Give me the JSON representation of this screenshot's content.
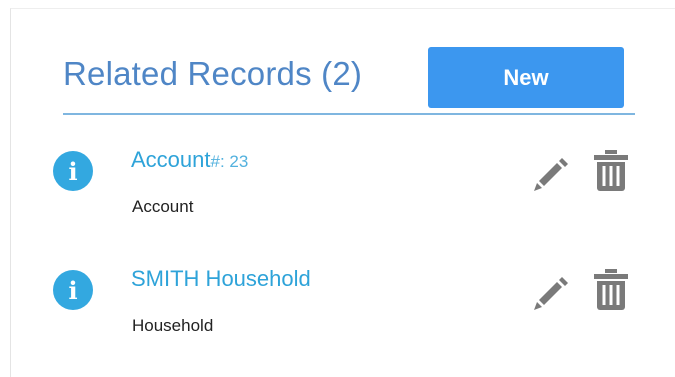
{
  "header": {
    "title": "Related Records (2)",
    "new_label": "New"
  },
  "records": [
    {
      "name": "Account",
      "number": "#: 23",
      "type": "Account",
      "icon": "info-icon"
    },
    {
      "name": "SMITH Household",
      "number": "",
      "type": "Household",
      "icon": "info-icon"
    }
  ],
  "colors": {
    "title": "#4f86c6",
    "button": "#3c97ef",
    "link": "#2ea3d9",
    "icon_bg": "#33a8e0",
    "action_icon": "#7a7a7a"
  }
}
